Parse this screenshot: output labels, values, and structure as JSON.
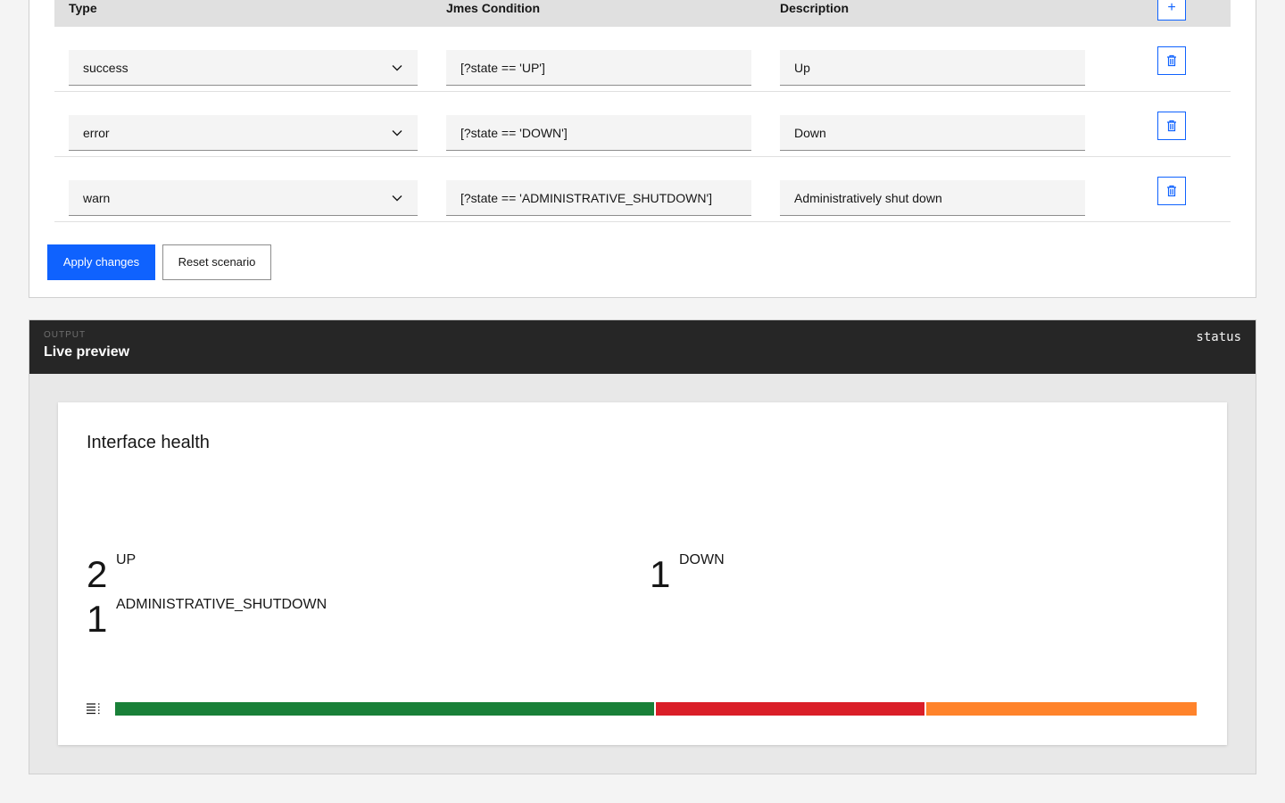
{
  "table": {
    "headers": {
      "type": "Type",
      "condition": "Jmes Condition",
      "description": "Description"
    },
    "add_label": "+",
    "rows": [
      {
        "type": "success",
        "condition": "[?state == 'UP']",
        "description": "Up"
      },
      {
        "type": "error",
        "condition": "[?state == 'DOWN']",
        "description": "Down"
      },
      {
        "type": "warn",
        "condition": "[?state == 'ADMINISTRATIVE_SHUTDOWN']",
        "description": "Administratively shut down"
      }
    ]
  },
  "actions": {
    "apply": "Apply changes",
    "reset": "Reset scenario"
  },
  "output": {
    "eyebrow": "OUTPUT",
    "title": "Live preview",
    "tag": "status"
  },
  "card": {
    "title": "Interface health",
    "stats": [
      {
        "count": "2",
        "label": "UP"
      },
      {
        "count": "1",
        "label": "DOWN"
      },
      {
        "count": "1",
        "label": "ADMINISTRATIVE_SHUTDOWN"
      }
    ],
    "distribution": [
      {
        "label": "UP",
        "count": 2,
        "color": "#198038"
      },
      {
        "label": "DOWN",
        "count": 1,
        "color": "#da1e28"
      },
      {
        "label": "ADMINISTRATIVE_SHUTDOWN",
        "count": 1,
        "color": "#ff832b"
      }
    ]
  },
  "icons": {
    "add": "plus-icon",
    "delete": "trash-icon",
    "chevron": "chevron-down-icon",
    "legend": "list-icon"
  },
  "colors": {
    "accent": "#0f62fe",
    "header_dark": "#262626"
  }
}
